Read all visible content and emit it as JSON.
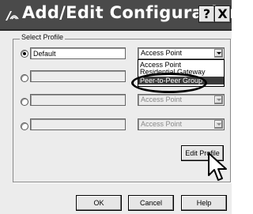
{
  "window": {
    "title": "Add/Edit Configuration ...",
    "help_button": "?",
    "close_button": "X"
  },
  "profiles": {
    "group_label": "Select Profile",
    "rows": [
      {
        "name": "Default",
        "selected": true,
        "type": "Access Point"
      },
      {
        "name": "",
        "selected": false,
        "type": ""
      },
      {
        "name": "",
        "selected": false,
        "type": "Access Point"
      },
      {
        "name": "",
        "selected": false,
        "type": "Access Point"
      }
    ]
  },
  "dropdown": {
    "options": [
      "Access Point",
      "Residential Gateway",
      "Peer-to-Peer Group"
    ],
    "highlighted": "Peer-to-Peer Group"
  },
  "buttons": {
    "edit_profile": "Edit Profile",
    "ok": "OK",
    "cancel": "Cancel",
    "help": "Help"
  }
}
